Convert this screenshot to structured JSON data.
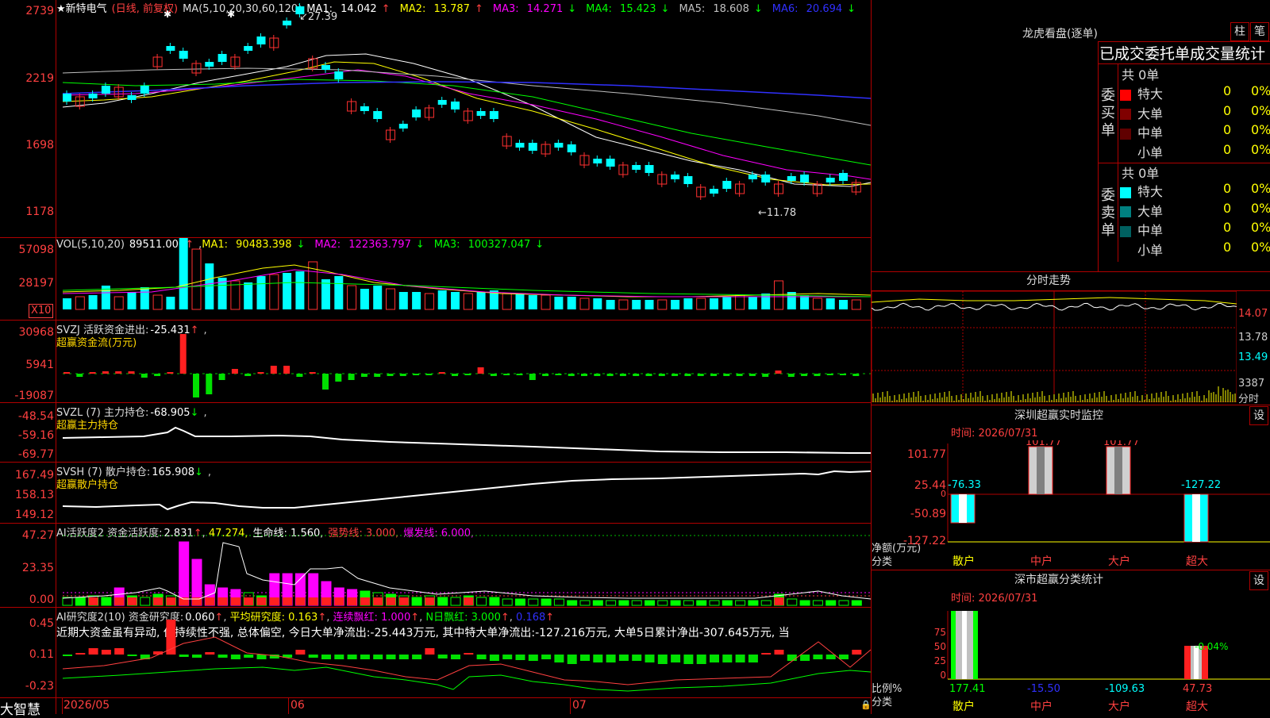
{
  "main_chart": {
    "star": "★",
    "stock_name": "新特电气",
    "period": "(日线, 前复权)",
    "ma_label": "MA(5,10,20,30,60,120)",
    "ma": [
      {
        "name": "MA1:",
        "value": "14.042",
        "arrow": "↑",
        "color": "#ffffff"
      },
      {
        "name": "MA2:",
        "value": "13.787",
        "arrow": "↑",
        "color": "#ffff00"
      },
      {
        "name": "MA3:",
        "value": "14.271",
        "arrow": "↓",
        "color": "#ff00ff"
      },
      {
        "name": "MA4:",
        "value": "15.423",
        "arrow": "↓",
        "color": "#00ff00"
      },
      {
        "name": "MA5:",
        "value": "18.608",
        "arrow": "↓",
        "color": "#c0c0c0"
      },
      {
        "name": "MA6:",
        "value": "20.694",
        "arrow": "↓",
        "color": "#3030ff"
      }
    ],
    "y_ticks": [
      "2739",
      "2219",
      "1698",
      "1178"
    ],
    "high_label": "27.39",
    "low_label": "←11.78"
  },
  "vol_chart": {
    "label": "VOL(5,10,20)",
    "value": "89511.000",
    "ma": [
      {
        "name": "MA1:",
        "value": "90483.398",
        "arrow": "↓",
        "color": "#ffff00"
      },
      {
        "name": "MA2:",
        "value": "122363.797",
        "arrow": "↓",
        "color": "#ff00ff"
      },
      {
        "name": "MA3:",
        "value": "100327.047",
        "arrow": "↓",
        "color": "#00ff00"
      }
    ],
    "y_ticks": [
      "57098",
      "28197"
    ],
    "unit": "X10"
  },
  "svzj": {
    "label": "SVZJ  活跃资金进出:",
    "value": "-25.431",
    "sub": "超赢资金流(万元)",
    "y_ticks": [
      "30968",
      "5941",
      "-19087"
    ]
  },
  "svzl": {
    "label": "SVZL (7) 主力持仓:",
    "value": "-68.905",
    "sub": "超赢主力持仓",
    "y_ticks": [
      "-48.54",
      "-59.16",
      "-69.77"
    ]
  },
  "svsh": {
    "label": "SVSH (7) 散户持仓:",
    "value": "165.908",
    "sub": "超赢散户持仓",
    "y_ticks": [
      "167.49",
      "158.13",
      "149.12"
    ]
  },
  "ai_active": {
    "label": "AI活跃度2 资金活跃度:",
    "value": "2.831",
    "v2": "47.274,",
    "life": "生命线: 1.560,",
    "strong": "强势线: 3.000,",
    "burst": "爆发线: 6.000,",
    "y_ticks": [
      "47.27",
      "23.35",
      "0.00"
    ]
  },
  "ai_research": {
    "label": "AI研究度2(10) 资金研究度:",
    "value": "0.060",
    "avg": "平均研究度: 0.163",
    "red": "连续飘红: 1.000",
    "nred": "N日飘红: 3.000",
    "last": "0.168",
    "comment": "近期大资金虽有异动, 但持续性不强, 总体偏空, 今日大单净流出:-25.443万元, 其中特大单净流出:-127.216万元, 大单5日累计净出-307.645万元, 当",
    "y_ticks": [
      "0.45",
      "0.11",
      "-0.23"
    ]
  },
  "x_axis": {
    "labels": [
      "2026/05",
      "06",
      "07"
    ]
  },
  "brand": "大智慧",
  "lhb": {
    "title": "龙虎看盘(逐单)",
    "btn1": "柱",
    "btn2": "笔",
    "subtitle": "已成交委托单成交量统计",
    "buy": {
      "side": "委买单",
      "total": "共 0单",
      "rows": [
        {
          "name": "特大",
          "vol": "0",
          "pct": "0%",
          "color": "#ff0000"
        },
        {
          "name": "大单",
          "vol": "0",
          "pct": "0%",
          "color": "#800000"
        },
        {
          "name": "中单",
          "vol": "0",
          "pct": "0%",
          "color": "#600000"
        },
        {
          "name": "小单",
          "vol": "0",
          "pct": "0%",
          "color": "#000000"
        }
      ]
    },
    "sell": {
      "side": "委卖单",
      "total": "共 0单",
      "rows": [
        {
          "name": "特大",
          "vol": "0",
          "pct": "0%",
          "color": "#00ffff"
        },
        {
          "name": "大单",
          "vol": "0",
          "pct": "0%",
          "color": "#008080"
        },
        {
          "name": "中单",
          "vol": "0",
          "pct": "0%",
          "color": "#006060"
        },
        {
          "name": "小单",
          "vol": "0",
          "pct": "0%",
          "color": "#000000"
        }
      ]
    }
  },
  "intraday": {
    "title": "分时走势",
    "y_ticks": [
      "14.07",
      "13.78",
      "13.49",
      "3387",
      "分时"
    ]
  },
  "sz_monitor": {
    "title": "深圳超赢实时监控",
    "btn": "设",
    "time": "时间: 2026/07/31",
    "y_ticks": [
      "101.77",
      "25.44",
      "0",
      "-50.89",
      "-127.22"
    ],
    "ylabel": "净额(万元)",
    "xlabel": "分类",
    "categories": [
      "散户",
      "中户",
      "大户",
      "超大"
    ],
    "values": [
      -76.33,
      101.77,
      101.77,
      -127.22
    ],
    "value_labels": [
      "-76.33",
      "101.77",
      "101.77",
      "-127.22"
    ]
  },
  "sz_stats": {
    "title": "深市超赢分类统计",
    "btn": "设",
    "time": "时间: 2026/07/31",
    "y_ticks": [
      "75",
      "50",
      "25",
      "0"
    ],
    "ylabel": "比例%",
    "xlabel": "分类",
    "categories": [
      "散户",
      "中户",
      "大户",
      "超大"
    ],
    "values": [
      177.41,
      -15.5,
      -109.63,
      47.73
    ],
    "value_labels": [
      "177.41",
      "-15.50",
      "-109.63",
      "47.73"
    ],
    "extra_label": "-0.04%"
  }
}
